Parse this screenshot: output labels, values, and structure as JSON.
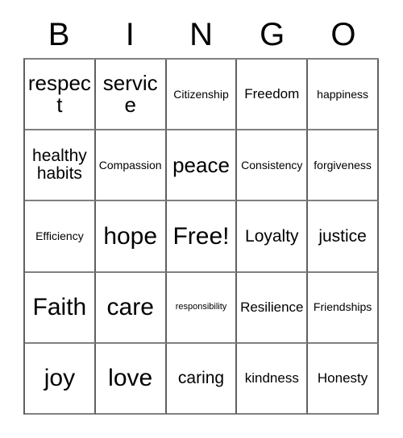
{
  "card": {
    "header": {
      "letters": [
        {
          "label": "B"
        },
        {
          "label": "I"
        },
        {
          "label": "N"
        },
        {
          "label": "G"
        },
        {
          "label": "O"
        }
      ]
    },
    "colors": {
      "text": "#000000",
      "background": "#ffffff",
      "grid_line": "#707070"
    },
    "grid": {
      "columns": 5,
      "rows": 5,
      "cells": [
        {
          "text": "respect",
          "size": "lg"
        },
        {
          "text": "service",
          "size": "lg"
        },
        {
          "text": "Citizenship",
          "size": "xs"
        },
        {
          "text": "Freedom",
          "size": "sm"
        },
        {
          "text": "happiness",
          "size": "xs"
        },
        {
          "text": "healthy habits",
          "size": "md"
        },
        {
          "text": "Compassion",
          "size": "xs"
        },
        {
          "text": "peace",
          "size": "lg"
        },
        {
          "text": "Consistency",
          "size": "xs"
        },
        {
          "text": "forgiveness",
          "size": "xs"
        },
        {
          "text": "Efficiency",
          "size": "xs"
        },
        {
          "text": "hope",
          "size": "xl"
        },
        {
          "text": "Free!",
          "size": "xl"
        },
        {
          "text": "Loyalty",
          "size": "md"
        },
        {
          "text": "justice",
          "size": "md"
        },
        {
          "text": "Faith",
          "size": "xl"
        },
        {
          "text": "care",
          "size": "xl"
        },
        {
          "text": "responsibility",
          "size": "xxs"
        },
        {
          "text": "Resilience",
          "size": "sm"
        },
        {
          "text": "Friendships",
          "size": "xs"
        },
        {
          "text": "joy",
          "size": "xl"
        },
        {
          "text": "love",
          "size": "xl"
        },
        {
          "text": "caring",
          "size": "md"
        },
        {
          "text": "kindness",
          "size": "sm"
        },
        {
          "text": "Honesty",
          "size": "sm"
        }
      ]
    }
  }
}
